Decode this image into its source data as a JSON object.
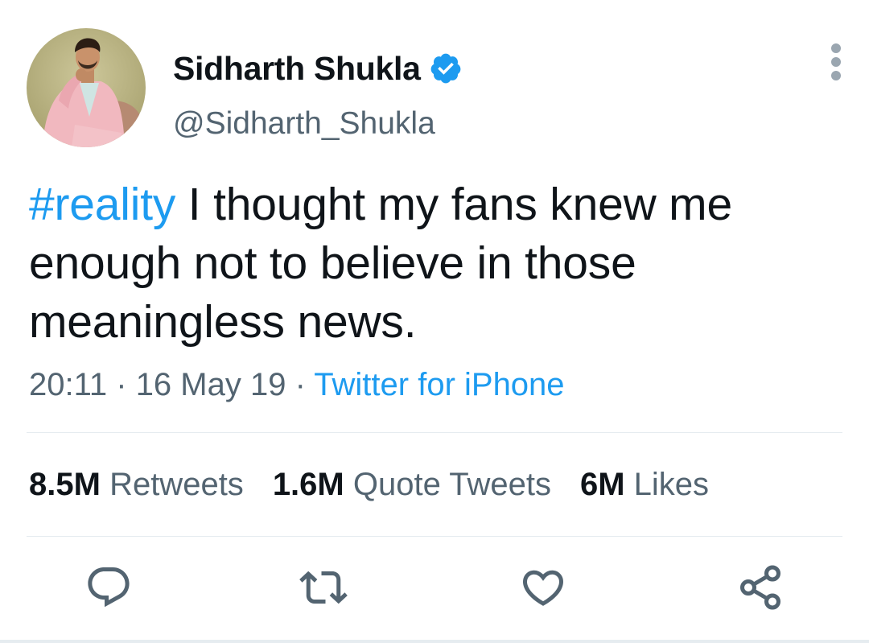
{
  "author": {
    "display_name": "Sidharth Shukla",
    "handle": "@Sidharth_Shukla",
    "verified": true
  },
  "tweet": {
    "hashtag": "#reality",
    "text": " I thought my fans knew me enough not to believe in those meaningless news."
  },
  "meta": {
    "time": "20:11",
    "separator_1": " · ",
    "date": "16 May 19",
    "separator_2": " · ",
    "source": "Twitter for iPhone"
  },
  "stats": {
    "retweets_value": "8.5M",
    "retweets_label": "Retweets",
    "quotes_value": "1.6M",
    "quotes_label": "Quote Tweets",
    "likes_value": "6M",
    "likes_label": "Likes"
  },
  "icons": {
    "verified": "verified-badge-icon",
    "more": "more-vertical-icon",
    "reply": "reply-icon",
    "retweet": "retweet-icon",
    "like": "heart-icon",
    "share": "share-icon"
  },
  "colors": {
    "accent": "#1d9bf0",
    "text_primary": "#0f1419",
    "text_secondary": "#536471",
    "divider": "#e6ecf0"
  }
}
